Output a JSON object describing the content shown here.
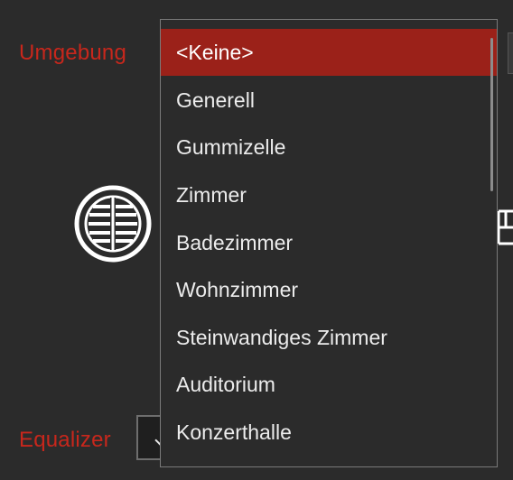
{
  "labels": {
    "umgebung": "Umgebung",
    "equalizer": "Equalizer"
  },
  "dropdown": {
    "selected_index": 0,
    "items": [
      "<Keine>",
      "Generell",
      "Gummizelle",
      "Zimmer",
      "Badezimmer",
      "Wohnzimmer",
      "Steinwandiges Zimmer",
      "Auditorium",
      "Konzerthalle"
    ]
  },
  "icons": {
    "effect": "circle-grid-icon",
    "equalizer_chevron": "chevron-left-icon",
    "edge": "panel-icon"
  },
  "colors": {
    "background": "#2b2b2b",
    "label": "#c8271c",
    "selected": "#9b2119",
    "text": "#ececec"
  }
}
